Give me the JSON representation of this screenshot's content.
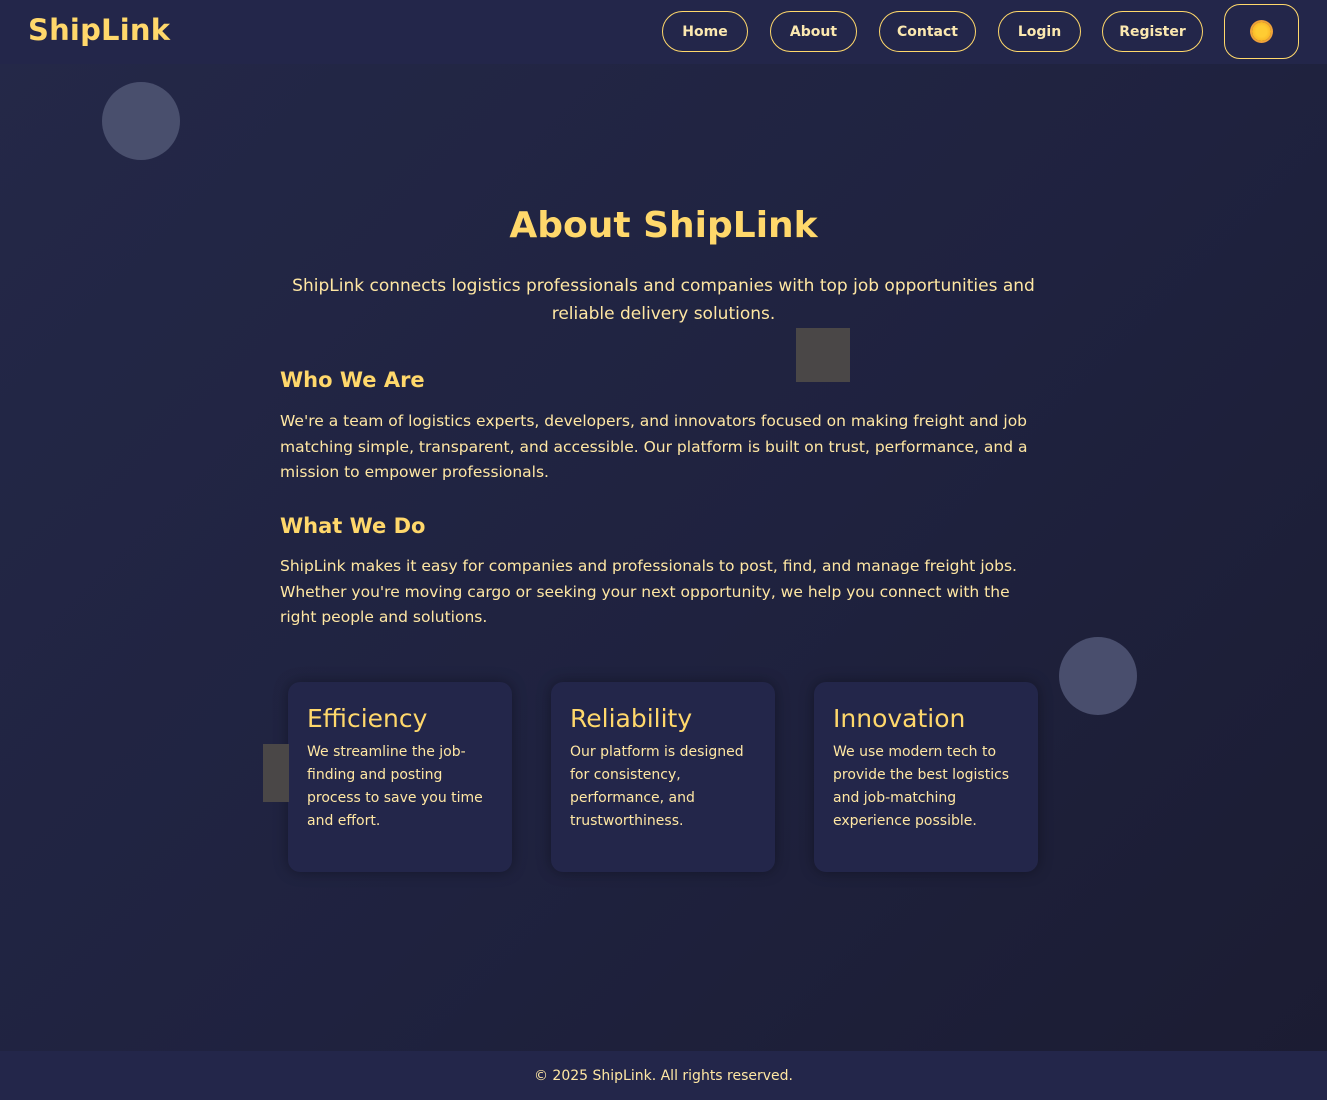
{
  "navbar": {
    "brand": "ShipLink",
    "links": [
      "Home",
      "About",
      "Contact",
      "Login",
      "Register"
    ],
    "theme_toggle_icon": "sun-icon"
  },
  "main": {
    "title": "About ShipLink",
    "intro": "ShipLink connects logistics professionals and companies with top job opportunities and reliable delivery solutions.",
    "sections": [
      {
        "heading": "Who We Are",
        "text": "We're a team of logistics experts, developers, and innovators focused on making freight and job matching simple, transparent, and accessible. Our platform is built on trust, performance, and a mission to empower professionals."
      },
      {
        "heading": "What We Do",
        "text": "ShipLink makes it easy for companies and professionals to post, find, and manage freight jobs. Whether you're moving cargo or seeking your next opportunity, we help you connect with the right people and solutions."
      }
    ],
    "cards": [
      {
        "title": "Efficiency",
        "text": "We streamline the job-finding and posting process to save you time and effort."
      },
      {
        "title": "Reliability",
        "text": "Our platform is designed for consistency, performance, and trustworthiness."
      },
      {
        "title": "Innovation",
        "text": "We use modern tech to provide the best logistics and job-matching experience possible."
      }
    ]
  },
  "footer": {
    "text": "© 2025 ShipLink. All rights reserved."
  },
  "colors": {
    "accent": "#ffd86b",
    "background": "#1f223f",
    "surface": "#23264a"
  }
}
